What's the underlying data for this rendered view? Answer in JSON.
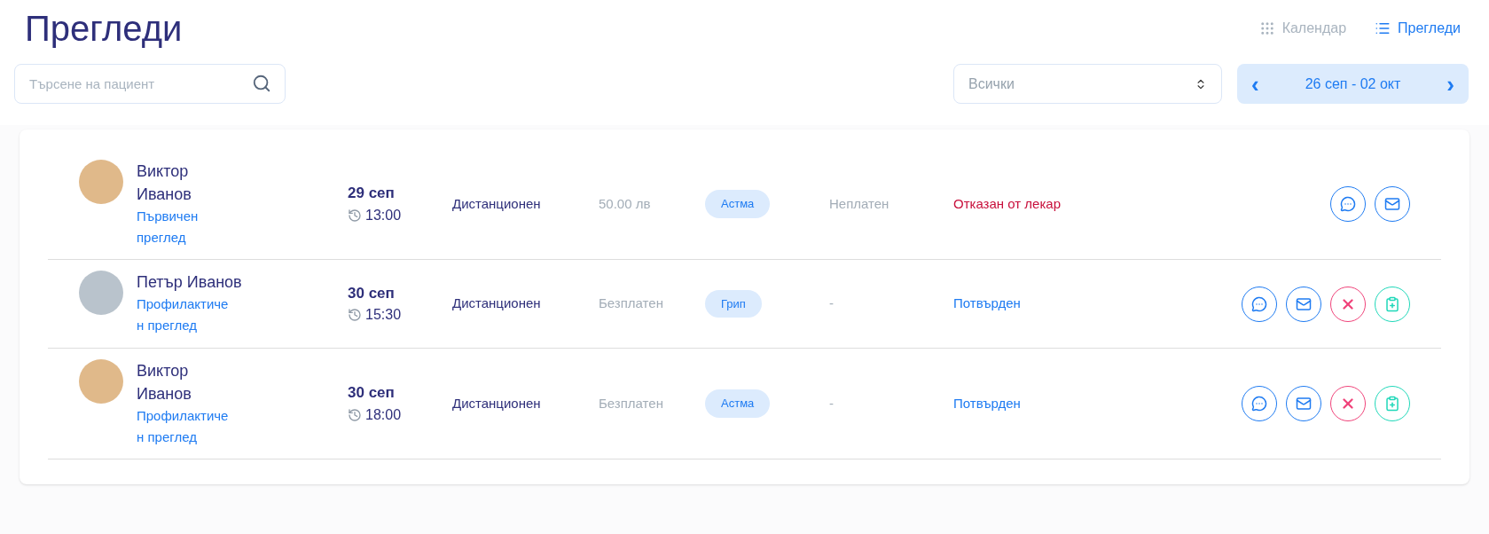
{
  "title": "Прегледи",
  "views": [
    {
      "kind": "grid",
      "label": "Календар",
      "selected": false
    },
    {
      "kind": "list",
      "label": "Прегледи",
      "selected": true
    }
  ],
  "search": {
    "placeholder": "Търсене на пациент"
  },
  "filter": {
    "value": "Всички"
  },
  "date_range": {
    "prev": "‹",
    "label": "26 сеп - 02 окт",
    "next": "›"
  },
  "appointments": [
    {
      "name_lines": [
        "Виктор",
        "Иванов"
      ],
      "type_lines": [
        "Първичен",
        "преглед"
      ],
      "date": "29 сеп",
      "time": "13:00",
      "mode": "Дистанционен",
      "price": "50.00 лв",
      "tag": "Астма",
      "payment": "Неплатен",
      "status": {
        "text": "Отказан от лекар",
        "kind": "rejected"
      },
      "avatar": {
        "kind": "child"
      },
      "actions": [
        {
          "kind": "chat"
        },
        {
          "kind": "mail"
        }
      ]
    },
    {
      "name_lines": [
        "Петър Иванов"
      ],
      "type_lines": [
        "Профилактиче",
        "н преглед"
      ],
      "date": "30 сеп",
      "time": "15:30",
      "mode": "Дистанционен",
      "price": "Безплатен",
      "tag": "Грип",
      "payment": "-",
      "status": {
        "text": "Потвърден",
        "kind": "confirmed"
      },
      "avatar": {
        "kind": "adult"
      },
      "actions": [
        {
          "kind": "chat"
        },
        {
          "kind": "mail"
        },
        {
          "kind": "cancel"
        },
        {
          "kind": "clipboard"
        }
      ]
    },
    {
      "name_lines": [
        "Виктор",
        "Иванов"
      ],
      "type_lines": [
        "Профилактиче",
        "н преглед"
      ],
      "date": "30 сеп",
      "time": "18:00",
      "mode": "Дистанционен",
      "price": "Безплатен",
      "tag": "Астма",
      "payment": "-",
      "status": {
        "text": "Потвърден",
        "kind": "confirmed"
      },
      "avatar": {
        "kind": "child"
      },
      "actions": [
        {
          "kind": "chat"
        },
        {
          "kind": "mail"
        },
        {
          "kind": "cancel"
        },
        {
          "kind": "clipboard"
        }
      ]
    }
  ]
}
